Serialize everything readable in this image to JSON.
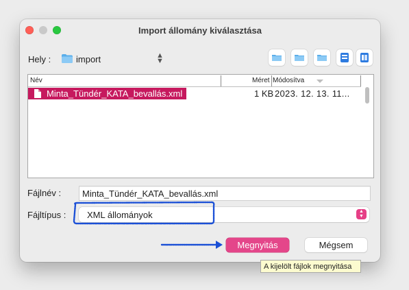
{
  "window": {
    "title": "Import állomány kiválasztása"
  },
  "location": {
    "label": "Hely :",
    "value": "import",
    "toolbar_icons": [
      "folder-up-icon",
      "folder-home-icon",
      "new-folder-icon",
      "list-view-icon",
      "details-view-icon"
    ]
  },
  "file_list": {
    "columns": [
      "Név",
      "Méret",
      "Módosítva"
    ],
    "rows": [
      {
        "name": "Minta_Tündér_KATA_bevallás.xml",
        "size": "1 KB",
        "modified": "2023. 12. 13. 11..."
      }
    ]
  },
  "filename": {
    "label": "Fájlnév :",
    "value": "Minta_Tündér_KATA_bevallás.xml"
  },
  "filetype": {
    "label": "Fájltípus :",
    "value": "XML állományok"
  },
  "buttons": {
    "open": "Megnyitás",
    "cancel": "Mégsem"
  },
  "tooltip": "A kijelölt fájlok megnyitása",
  "colors": {
    "accent": "#e4468a",
    "selection": "#c6195e",
    "annotation": "#1a4fd6"
  }
}
